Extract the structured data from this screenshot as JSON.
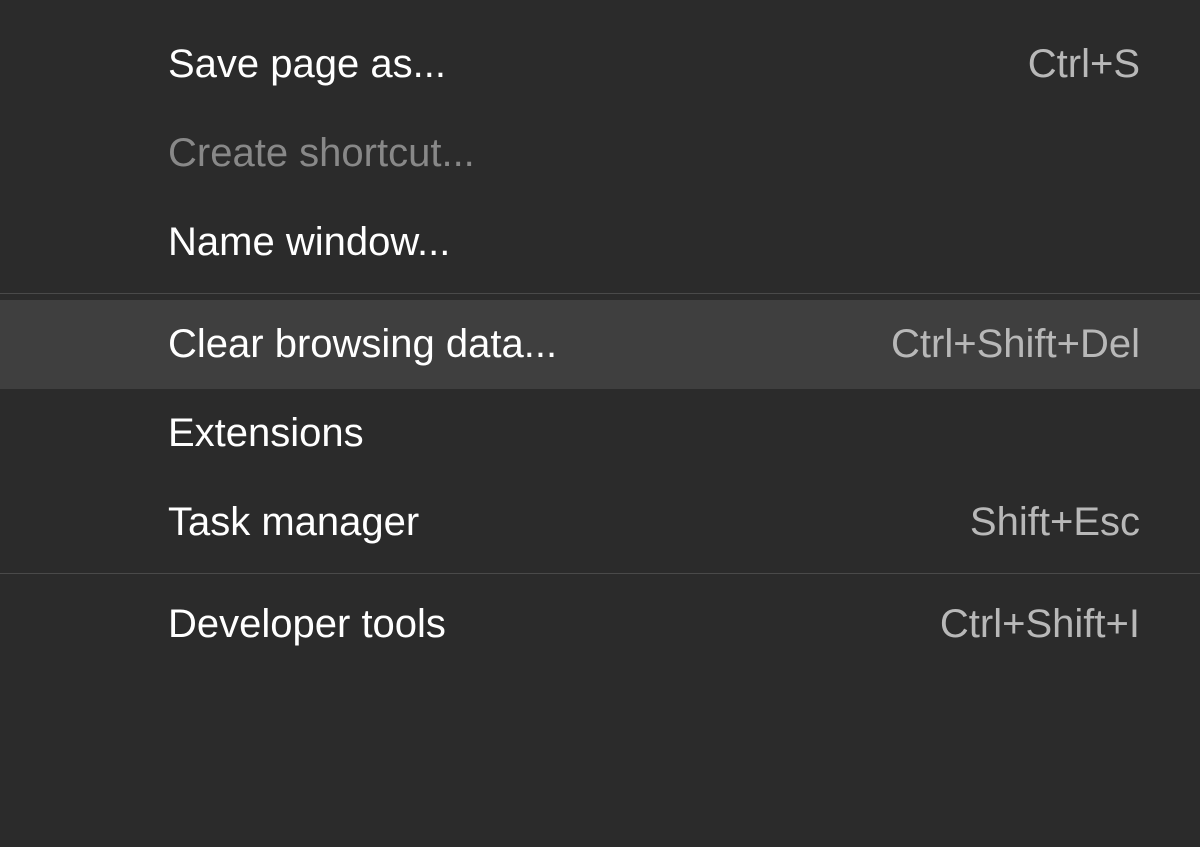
{
  "menu": {
    "items": [
      {
        "label": "Save page as...",
        "shortcut": "Ctrl+S",
        "disabled": false,
        "hovered": false
      },
      {
        "label": "Create shortcut...",
        "shortcut": "",
        "disabled": true,
        "hovered": false
      },
      {
        "label": "Name window...",
        "shortcut": "",
        "disabled": false,
        "hovered": false
      },
      {
        "label": "Clear browsing data...",
        "shortcut": "Ctrl+Shift+Del",
        "disabled": false,
        "hovered": true
      },
      {
        "label": "Extensions",
        "shortcut": "",
        "disabled": false,
        "hovered": false
      },
      {
        "label": "Task manager",
        "shortcut": "Shift+Esc",
        "disabled": false,
        "hovered": false
      },
      {
        "label": "Developer tools",
        "shortcut": "Ctrl+Shift+I",
        "disabled": false,
        "hovered": false
      }
    ]
  }
}
